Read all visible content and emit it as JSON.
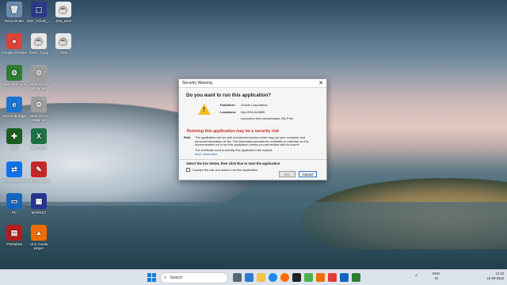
{
  "desktop": {
    "icons": [
      {
        "label": "Recycle Bin",
        "glyph": "🗑",
        "color": "#6b8cae"
      },
      {
        "label": "DSF_TOUR_...",
        "glyph": "⬚",
        "color": "#2a3a8a"
      },
      {
        "label": "JDK_5KD",
        "glyph": "☕",
        "color": "#e8e8e8"
      },
      {
        "label": "Google Chrome",
        "glyph": "●",
        "color": "#db4437"
      },
      {
        "label": "OSB - Copy",
        "glyph": "☕",
        "color": "#e8e8e8"
      },
      {
        "label": "OSB",
        "glyph": "☕",
        "color": "#e8e8e8"
      },
      {
        "label": "Start Gear Icon",
        "glyph": "⚙",
        "color": "#2e7d32"
      },
      {
        "label": "Start OC4J Instance",
        "glyph": "⚙",
        "color": "#9e9e9e"
      },
      {
        "label": "Microsoft Edge",
        "glyph": "e",
        "color": "#1976d2"
      },
      {
        "label": "Stop OC4J Instance",
        "glyph": "⚙",
        "color": "#9e9e9e"
      },
      {
        "label": "Tally",
        "glyph": "✚",
        "color": "#1b5e20"
      },
      {
        "label": "Microsoft",
        "glyph": "X",
        "color": "#1e7145"
      },
      {
        "label": "TeamViewer 13",
        "glyph": "⇄",
        "color": "#0e72ed"
      },
      {
        "label": "Forms Builder",
        "glyph": "✎",
        "color": "#c62828"
      },
      {
        "label": "PC",
        "glyph": "▭",
        "color": "#1565c0"
      },
      {
        "label": "MARKET",
        "glyph": "▦",
        "color": "#283593"
      },
      {
        "label": "FORMS6i",
        "glyph": "▤",
        "color": "#b71c1c"
      },
      {
        "label": "VLC media player",
        "glyph": "▲",
        "color": "#ef6c00"
      }
    ]
  },
  "dialog": {
    "title": "Security Warning",
    "close": "✕",
    "heading": "Do you want to run this application?",
    "publisher_label": "Publisher:",
    "publisher_value": "Oracle Corporation",
    "locations_label": "Locations:",
    "locations_value": "http://RAJA:8889",
    "launched": "Launched from downloaded JNLP file",
    "risk_title": "Running this application may be a security risk",
    "risk_label": "Risk:",
    "risk_text": "This application will run with unrestricted access which may put your computer and personal information at risk. The information provided is unreliable or unknown so it is recommended not to run this application unless you are familiar with its source",
    "cert_text": "The certificate used to identify this application has expired.",
    "more_info": "More Information",
    "instruction": "Select the box below, then click Run to start the application",
    "checkbox_label": "I accept the risk and want to run this application.",
    "run_label": "Run",
    "cancel_label": "Cancel"
  },
  "taskbar": {
    "search_placeholder": "Search",
    "lang_top": "ENG",
    "lang_bottom": "IN",
    "time": "12:42",
    "date": "10-09-2023"
  }
}
